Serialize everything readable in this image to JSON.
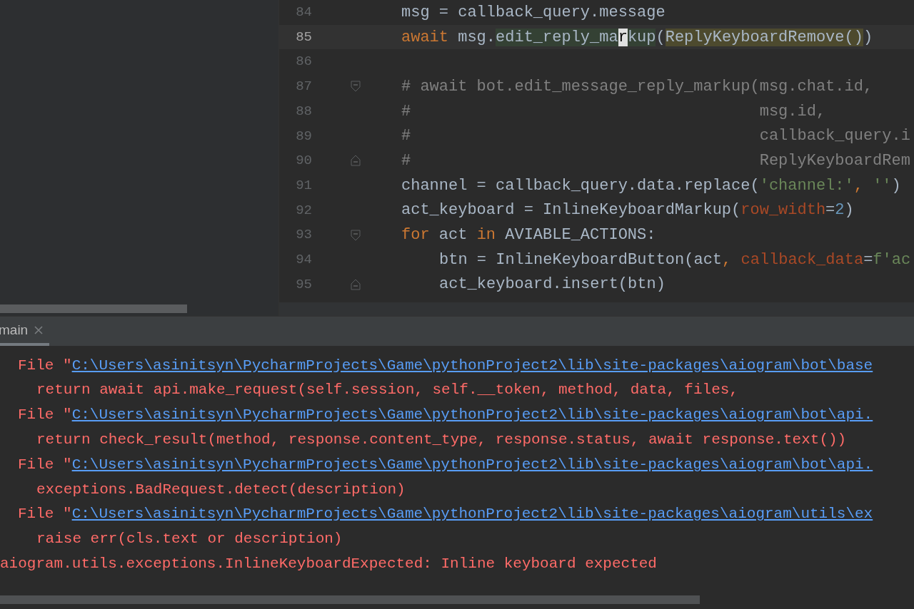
{
  "editor": {
    "lines": [
      {
        "number": "84",
        "current": false,
        "fold_start": false,
        "fold_end": false,
        "segments": [
          {
            "text": "msg = callback_query.message",
            "kind": "plain"
          }
        ]
      },
      {
        "number": "85",
        "current": true,
        "fold_start": false,
        "fold_end": false,
        "segments": [
          {
            "text": "await",
            "kind": "keyword"
          },
          {
            "text": " msg.",
            "kind": "plain"
          },
          {
            "text": "edit_reply_ma",
            "kind": "usage"
          },
          {
            "text": "r",
            "kind": "caret"
          },
          {
            "text": "kup",
            "kind": "usage"
          },
          {
            "text": "(",
            "kind": "plain"
          },
          {
            "text": "ReplyKeyboardRemove()",
            "kind": "brace"
          },
          {
            "text": ")",
            "kind": "plain"
          }
        ]
      },
      {
        "number": "86",
        "current": false,
        "fold_start": false,
        "fold_end": false
      },
      {
        "number": "87",
        "current": false,
        "fold_start": true,
        "fold_end": false,
        "segments": [
          {
            "text": "# await bot.edit_message_reply_markup(msg.chat.id,",
            "kind": "comment"
          }
        ]
      },
      {
        "number": "88",
        "current": false,
        "fold_start": false,
        "fold_end": false,
        "segments": [
          {
            "text": "#                                     msg.id,",
            "kind": "comment"
          }
        ]
      },
      {
        "number": "89",
        "current": false,
        "fold_start": false,
        "fold_end": false,
        "segments": [
          {
            "text": "#                                     callback_query.i",
            "kind": "comment"
          }
        ]
      },
      {
        "number": "90",
        "current": false,
        "fold_start": false,
        "fold_end": true,
        "segments": [
          {
            "text": "#                                     ReplyKeyboardRem",
            "kind": "comment"
          }
        ]
      },
      {
        "number": "91",
        "current": false,
        "fold_start": false,
        "fold_end": false,
        "segments": [
          {
            "text": "channel = callback_query.data.replace(",
            "kind": "plain"
          },
          {
            "text": "'channel:'",
            "kind": "string"
          },
          {
            "text": ", ",
            "kind": "keyword"
          },
          {
            "text": "''",
            "kind": "string"
          },
          {
            "text": ")",
            "kind": "plain"
          }
        ]
      },
      {
        "number": "92",
        "current": false,
        "fold_start": false,
        "fold_end": false,
        "segments": [
          {
            "text": "act_keyboard = InlineKeyboardMarkup(",
            "kind": "plain"
          },
          {
            "text": "row_width",
            "kind": "param"
          },
          {
            "text": "=",
            "kind": "plain"
          },
          {
            "text": "2",
            "kind": "number"
          },
          {
            "text": ")",
            "kind": "plain"
          }
        ]
      },
      {
        "number": "93",
        "current": false,
        "fold_start": true,
        "fold_end": false,
        "segments": [
          {
            "text": "for",
            "kind": "keyword"
          },
          {
            "text": " act ",
            "kind": "plain"
          },
          {
            "text": "in",
            "kind": "keyword"
          },
          {
            "text": " AVIABLE_ACTIONS:",
            "kind": "plain"
          }
        ],
        "children": [
          {
            "number": "94",
            "current": false,
            "fold_start": false,
            "fold_end": false,
            "segments": [
              {
                "text": "btn = InlineKeyboardButton(act",
                "kind": "plain"
              },
              {
                "text": ", ",
                "kind": "keyword"
              },
              {
                "text": "callback_data",
                "kind": "param"
              },
              {
                "text": "=",
                "kind": "plain"
              },
              {
                "text": "f'ac",
                "kind": "string"
              }
            ]
          },
          {
            "number": "95",
            "current": false,
            "fold_start": false,
            "fold_end": true,
            "segments": [
              {
                "text": "act_keyboard.insert(btn)",
                "kind": "plain"
              }
            ]
          }
        ]
      }
    ]
  },
  "run_panel": {
    "tabs": [
      {
        "label": "main",
        "selected": true
      }
    ],
    "lines": [
      {
        "kind": "file",
        "prefix": "File \"",
        "link": "C:\\Users\\asinitsyn\\PycharmProjects\\Game\\pythonProject2\\lib\\site-packages\\aiogram\\bot\\base"
      },
      {
        "kind": "code",
        "text": "return await api.make_request(self.session, self.__token, method, data, files,"
      },
      {
        "kind": "file",
        "prefix": "File \"",
        "link": "C:\\Users\\asinitsyn\\PycharmProjects\\Game\\pythonProject2\\lib\\site-packages\\aiogram\\bot\\api."
      },
      {
        "kind": "code",
        "text": "return check_result(method, response.content_type, response.status, await response.text())"
      },
      {
        "kind": "file",
        "prefix": "File \"",
        "link": "C:\\Users\\asinitsyn\\PycharmProjects\\Game\\pythonProject2\\lib\\site-packages\\aiogram\\bot\\api."
      },
      {
        "kind": "code",
        "text": "exceptions.BadRequest.detect(description)"
      },
      {
        "kind": "file",
        "prefix": "File \"",
        "link": "C:\\Users\\asinitsyn\\PycharmProjects\\Game\\pythonProject2\\lib\\site-packages\\aiogram\\utils\\ex"
      },
      {
        "kind": "code",
        "text": "raise err(cls.text or description)"
      },
      {
        "kind": "error",
        "text": "aiogram.utils.exceptions.InlineKeyboardExpected: Inline keyboard expected"
      }
    ]
  }
}
